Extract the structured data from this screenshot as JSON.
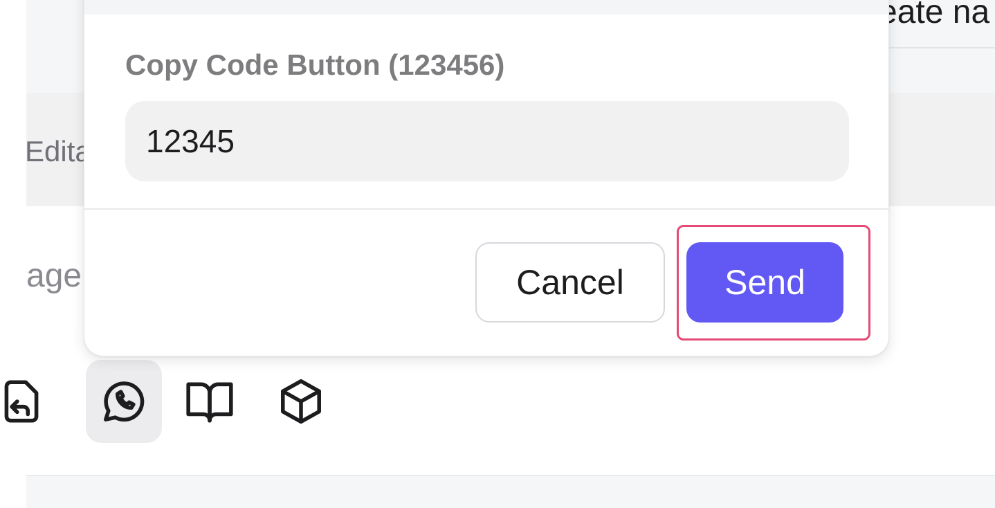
{
  "background": {
    "top_right_text": "eate na",
    "edit_label_partial": "Edita",
    "message_placeholder_partial": "age"
  },
  "toolbar": {
    "icons": [
      {
        "name": "reply-document-icon",
        "active": false
      },
      {
        "name": "whatsapp-icon",
        "active": true
      },
      {
        "name": "book-icon",
        "active": false
      },
      {
        "name": "cube-icon",
        "active": false
      }
    ]
  },
  "dialog": {
    "field_label": "Copy Code Button (123456)",
    "field_value": "12345",
    "cancel_label": "Cancel",
    "send_label": "Send"
  },
  "colors": {
    "accent": "#6259f5",
    "highlight": "#e44a74"
  }
}
